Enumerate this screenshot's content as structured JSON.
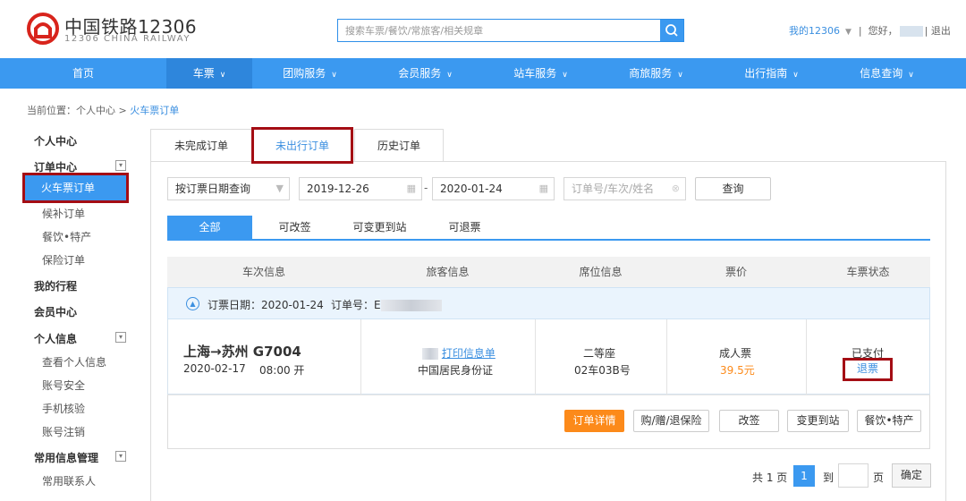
{
  "header": {
    "logo_cn": "中国铁路12306",
    "logo_en": "12306 CHINA RAILWAY",
    "search_placeholder": "搜索车票/餐饮/常旅客/相关规章",
    "my12306": "我的12306",
    "hello": "您好，",
    "logout": "退出"
  },
  "nav": [
    "首页",
    "车票",
    "团购服务",
    "会员服务",
    "站车服务",
    "商旅服务",
    "出行指南",
    "信息查询"
  ],
  "breadcrumb": {
    "prefix": "当前位置：个人中心 > ",
    "current": "火车票订单"
  },
  "sidebar": {
    "personal_center": "个人中心",
    "order_center": "订单中心",
    "train_orders": "火车票订单",
    "waitlist": "候补订单",
    "catering": "餐饮•特产",
    "insurance": "保险订单",
    "my_trips": "我的行程",
    "member_center": "会员中心",
    "personal_info": "个人信息",
    "view_info": "查看个人信息",
    "account_security": "账号安全",
    "phone_verify": "手机核验",
    "account_cancel": "账号注销",
    "common_info": "常用信息管理",
    "contacts": "常用联系人"
  },
  "tabs": [
    "未完成订单",
    "未出行订单",
    "历史订单"
  ],
  "filters": {
    "query_type": "按订票日期查询",
    "start_date": "2019-12-26",
    "date_sep": "-",
    "end_date": "2020-01-24",
    "keyword_placeholder": "订单号/车次/姓名",
    "query_button": "查询"
  },
  "status_tabs": [
    "全部",
    "可改签",
    "可变更到站",
    "可退票"
  ],
  "table": {
    "columns": [
      "车次信息",
      "旅客信息",
      "席位信息",
      "票价",
      "车票状态"
    ],
    "order_date_label": "订票日期：2020-01-24",
    "order_no_label": "订单号：E",
    "row": {
      "route": "上海→苏州 G7004",
      "date": "2020-02-17",
      "time": "08:00 开",
      "print_link": "打印信息单",
      "id_type": "中国居民身份证",
      "seat_class": "二等座",
      "seat_no": "02车03B号",
      "ticket_type": "成人票",
      "price": "39.5元",
      "status": "已支付",
      "refund_link": "退票"
    }
  },
  "actions": [
    "订单详情",
    "购/赠/退保险",
    "改签",
    "变更到站",
    "餐饮•特产"
  ],
  "pagination": {
    "total": "共 1 页",
    "current": "1",
    "to": "到",
    "page": "页",
    "confirm": "确定"
  }
}
